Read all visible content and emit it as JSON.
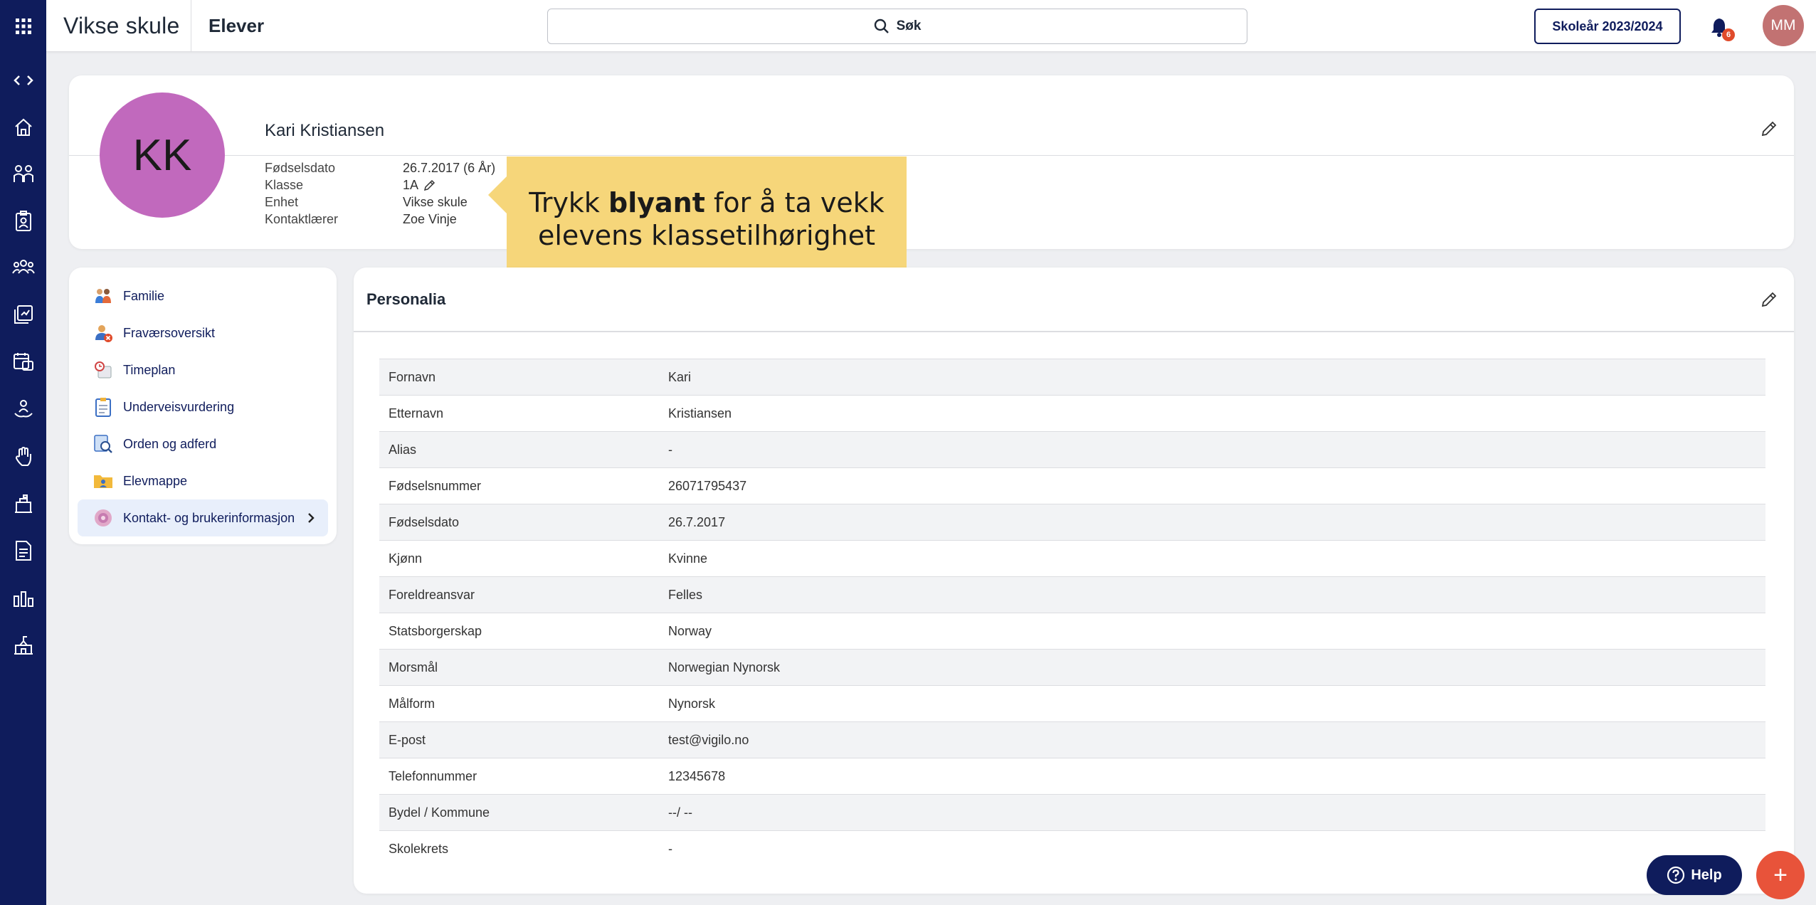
{
  "colors": {
    "rail": "#0f1c5c",
    "accent": "#0f1c5c",
    "avatar_large": "#c169bd",
    "avatar_user": "#c27272",
    "callout": "#f6d67a",
    "fab": "#e8533a"
  },
  "topbar": {
    "brand": "Vikse skule",
    "module": "Elever",
    "search_label": "Søk",
    "school_year": "Skoleår 2023/2024",
    "notifications_count": "6",
    "user_initials": "MM"
  },
  "rail_icons": [
    "apps-grid-icon",
    "code-toggle-icon",
    "home-icon",
    "students-icon",
    "badge-icon",
    "groups-icon",
    "assessment-icon",
    "calendar-icon",
    "person-hand-icon",
    "hand-raise-icon",
    "building-icon",
    "document-icon",
    "bar-chart-icon",
    "school-icon"
  ],
  "profile": {
    "initials": "KK",
    "name": "Kari Kristiansen",
    "fields": [
      {
        "label": "Fødselsdato",
        "value": "26.7.2017 (6 År)"
      },
      {
        "label": "Klasse",
        "value": "1A"
      },
      {
        "label": "Enhet",
        "value": "Vikse skule"
      },
      {
        "label": "Kontaktlærer",
        "value": "Zoe Vinje"
      }
    ]
  },
  "callout": {
    "pre": "Trykk ",
    "bold": "blyant",
    "post": " for å ta vekk",
    "line2": "elevens klassetilhørighet"
  },
  "menu": [
    {
      "label": "Familie",
      "icon": "family-icon"
    },
    {
      "label": "Fraværsoversikt",
      "icon": "absence-icon"
    },
    {
      "label": "Timeplan",
      "icon": "schedule-icon"
    },
    {
      "label": "Underveisvurdering",
      "icon": "clipboard-icon"
    },
    {
      "label": "Orden og adferd",
      "icon": "behavior-icon"
    },
    {
      "label": "Elevmappe",
      "icon": "folder-icon"
    },
    {
      "label": "Kontakt- og brukerinformasjon",
      "icon": "contact-icon",
      "active": true
    }
  ],
  "personalia": {
    "title": "Personalia",
    "rows": [
      {
        "k": "Fornavn",
        "v": "Kari"
      },
      {
        "k": "Etternavn",
        "v": "Kristiansen"
      },
      {
        "k": "Alias",
        "v": "-"
      },
      {
        "k": "Fødselsnummer",
        "v": "26071795437"
      },
      {
        "k": "Fødselsdato",
        "v": "26.7.2017"
      },
      {
        "k": "Kjønn",
        "v": "Kvinne"
      },
      {
        "k": "Foreldreansvar",
        "v": "Felles"
      },
      {
        "k": "Statsborgerskap",
        "v": "Norway"
      },
      {
        "k": "Morsmål",
        "v": "Norwegian Nynorsk"
      },
      {
        "k": "Målform",
        "v": "Nynorsk"
      },
      {
        "k": "E-post",
        "v": "test@vigilo.no"
      },
      {
        "k": "Telefonnummer",
        "v": "12345678"
      },
      {
        "k": "Bydel / Kommune",
        "v": "--/ --"
      },
      {
        "k": "Skolekrets",
        "v": "-"
      }
    ]
  },
  "help_label": "Help",
  "fab_label": "+"
}
